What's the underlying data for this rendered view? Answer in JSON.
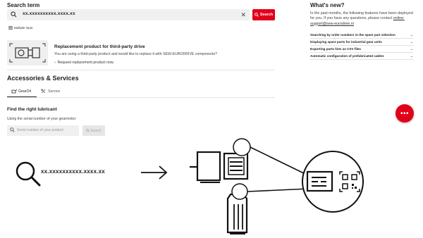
{
  "search": {
    "label": "Search term",
    "value": "xx.xxxxxxxxxx.xxxx.xx",
    "button_label": "Search",
    "multiple_input_label": "Multiple input"
  },
  "replacement": {
    "title": "Replacement product for third-party drive",
    "text": "You are using a third-party product and would like to replace it with SEW-EURODRIVE components?",
    "link": "Request replacement product now."
  },
  "accessories": {
    "title": "Accessories & Services",
    "tabs": [
      {
        "label": "GearOil"
      },
      {
        "label": "Service"
      }
    ]
  },
  "lubricant": {
    "title": "Find the right lubricant",
    "text": "Using the serial number of your gearmotor:",
    "placeholder": "Serial number of your product",
    "button_label": "Search"
  },
  "whats_new": {
    "title": "What's new?",
    "text": "In the past months, the following features have been deployed for you. If you have any questions, please contact",
    "email": "online-support@sew-eurodrive.nl",
    "items": [
      {
        "label": "Searching by order numbers in the spare part selection"
      },
      {
        "label": "Displaying spare parts for industrial gear units"
      },
      {
        "label": "Exporting parts lists as CSV files"
      },
      {
        "label": "Automatic configuration of prefabricated cables"
      }
    ]
  },
  "diagram": {
    "search_text": "xx.xxxxxxxxxx.xxxx.xx"
  },
  "colors": {
    "accent": "#e2001a"
  }
}
